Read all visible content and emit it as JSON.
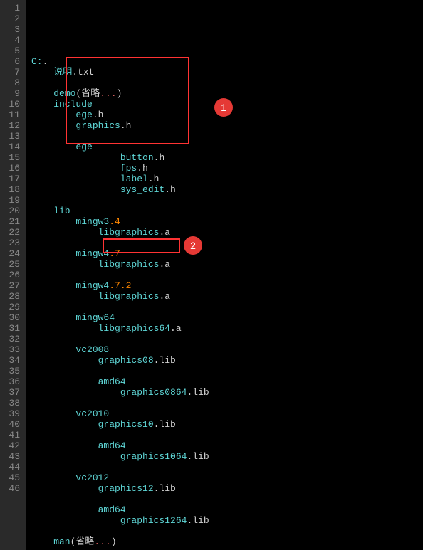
{
  "lines": [
    {
      "n": 1,
      "seg": [
        {
          "c": "c-teal",
          "t": "C:"
        },
        {
          "c": "c-white",
          "t": "."
        }
      ]
    },
    {
      "n": 2,
      "seg": [
        {
          "c": "c-teal",
          "t": "    说明"
        },
        {
          "c": "c-white",
          "t": ".txt"
        }
      ]
    },
    {
      "n": 3,
      "seg": [
        {
          "c": "",
          "t": ""
        }
      ]
    },
    {
      "n": 4,
      "seg": [
        {
          "c": "c-teal",
          "t": "    demo"
        },
        {
          "c": "c-white",
          "t": "(省略"
        },
        {
          "c": "c-red",
          "t": "..."
        },
        {
          "c": "c-white",
          "t": ")"
        }
      ]
    },
    {
      "n": 5,
      "seg": [
        {
          "c": "c-teal",
          "t": "    include"
        }
      ]
    },
    {
      "n": 6,
      "seg": [
        {
          "c": "c-teal",
          "t": "        ege"
        },
        {
          "c": "c-white",
          "t": ".h"
        }
      ]
    },
    {
      "n": 7,
      "seg": [
        {
          "c": "c-teal",
          "t": "        graphics"
        },
        {
          "c": "c-white",
          "t": ".h"
        }
      ]
    },
    {
      "n": 8,
      "seg": [
        {
          "c": "",
          "t": ""
        }
      ]
    },
    {
      "n": 9,
      "seg": [
        {
          "c": "c-teal",
          "t": "        ege"
        }
      ]
    },
    {
      "n": 10,
      "seg": [
        {
          "c": "c-teal",
          "t": "                button"
        },
        {
          "c": "c-white",
          "t": ".h"
        }
      ]
    },
    {
      "n": 11,
      "seg": [
        {
          "c": "c-teal",
          "t": "                fps"
        },
        {
          "c": "c-white",
          "t": ".h"
        }
      ]
    },
    {
      "n": 12,
      "seg": [
        {
          "c": "c-teal",
          "t": "                label"
        },
        {
          "c": "c-white",
          "t": ".h"
        }
      ]
    },
    {
      "n": 13,
      "seg": [
        {
          "c": "c-teal",
          "t": "                sys_edit"
        },
        {
          "c": "c-white",
          "t": ".h"
        }
      ]
    },
    {
      "n": 14,
      "seg": [
        {
          "c": "",
          "t": ""
        }
      ]
    },
    {
      "n": 15,
      "seg": [
        {
          "c": "c-teal",
          "t": "    lib"
        }
      ]
    },
    {
      "n": 16,
      "seg": [
        {
          "c": "c-teal",
          "t": "        mingw3"
        },
        {
          "c": "c-orange",
          "t": ".4"
        }
      ]
    },
    {
      "n": 17,
      "seg": [
        {
          "c": "c-teal",
          "t": "            libgraphics"
        },
        {
          "c": "c-white",
          "t": ".a"
        }
      ]
    },
    {
      "n": 18,
      "seg": [
        {
          "c": "",
          "t": ""
        }
      ]
    },
    {
      "n": 19,
      "seg": [
        {
          "c": "c-teal",
          "t": "        mingw4"
        },
        {
          "c": "c-orange",
          "t": ".7"
        }
      ]
    },
    {
      "n": 20,
      "seg": [
        {
          "c": "c-teal",
          "t": "            libgraphics"
        },
        {
          "c": "c-white",
          "t": ".a"
        }
      ]
    },
    {
      "n": 21,
      "seg": [
        {
          "c": "",
          "t": ""
        }
      ]
    },
    {
      "n": 22,
      "seg": [
        {
          "c": "c-teal",
          "t": "        mingw4"
        },
        {
          "c": "c-orange",
          "t": ".7.2"
        }
      ]
    },
    {
      "n": 23,
      "seg": [
        {
          "c": "c-teal",
          "t": "            libgraphics"
        },
        {
          "c": "c-white",
          "t": ".a"
        }
      ]
    },
    {
      "n": 24,
      "seg": [
        {
          "c": "",
          "t": ""
        }
      ]
    },
    {
      "n": 25,
      "seg": [
        {
          "c": "c-teal",
          "t": "        mingw64"
        }
      ]
    },
    {
      "n": 26,
      "seg": [
        {
          "c": "c-teal",
          "t": "            libgraphics64"
        },
        {
          "c": "c-white",
          "t": ".a"
        }
      ]
    },
    {
      "n": 27,
      "seg": [
        {
          "c": "",
          "t": ""
        }
      ]
    },
    {
      "n": 28,
      "seg": [
        {
          "c": "c-teal",
          "t": "        vc2008"
        }
      ]
    },
    {
      "n": 29,
      "seg": [
        {
          "c": "c-teal",
          "t": "            graphics08"
        },
        {
          "c": "c-white",
          "t": ".lib"
        }
      ]
    },
    {
      "n": 30,
      "seg": [
        {
          "c": "",
          "t": ""
        }
      ]
    },
    {
      "n": 31,
      "seg": [
        {
          "c": "c-teal",
          "t": "            amd64"
        }
      ]
    },
    {
      "n": 32,
      "seg": [
        {
          "c": "c-teal",
          "t": "                graphics0864"
        },
        {
          "c": "c-white",
          "t": ".lib"
        }
      ]
    },
    {
      "n": 33,
      "seg": [
        {
          "c": "",
          "t": ""
        }
      ]
    },
    {
      "n": 34,
      "seg": [
        {
          "c": "c-teal",
          "t": "        vc2010"
        }
      ]
    },
    {
      "n": 35,
      "seg": [
        {
          "c": "c-teal",
          "t": "            graphics10"
        },
        {
          "c": "c-white",
          "t": ".lib"
        }
      ]
    },
    {
      "n": 36,
      "seg": [
        {
          "c": "",
          "t": ""
        }
      ]
    },
    {
      "n": 37,
      "seg": [
        {
          "c": "c-teal",
          "t": "            amd64"
        }
      ]
    },
    {
      "n": 38,
      "seg": [
        {
          "c": "c-teal",
          "t": "                graphics1064"
        },
        {
          "c": "c-white",
          "t": ".lib"
        }
      ]
    },
    {
      "n": 39,
      "seg": [
        {
          "c": "",
          "t": ""
        }
      ]
    },
    {
      "n": 40,
      "seg": [
        {
          "c": "c-teal",
          "t": "        vc2012"
        }
      ]
    },
    {
      "n": 41,
      "seg": [
        {
          "c": "c-teal",
          "t": "            graphics12"
        },
        {
          "c": "c-white",
          "t": ".lib"
        }
      ]
    },
    {
      "n": 42,
      "seg": [
        {
          "c": "",
          "t": ""
        }
      ]
    },
    {
      "n": 43,
      "seg": [
        {
          "c": "c-teal",
          "t": "            amd64"
        }
      ]
    },
    {
      "n": 44,
      "seg": [
        {
          "c": "c-teal",
          "t": "                graphics1264"
        },
        {
          "c": "c-white",
          "t": ".lib"
        }
      ]
    },
    {
      "n": 45,
      "seg": [
        {
          "c": "",
          "t": ""
        }
      ]
    },
    {
      "n": 46,
      "seg": [
        {
          "c": "c-teal",
          "t": "    man"
        },
        {
          "c": "c-white",
          "t": "(省略"
        },
        {
          "c": "c-red",
          "t": "..."
        },
        {
          "c": "c-white",
          "t": ")"
        }
      ]
    }
  ],
  "annotations": {
    "badge1": "1",
    "badge2": "2"
  }
}
